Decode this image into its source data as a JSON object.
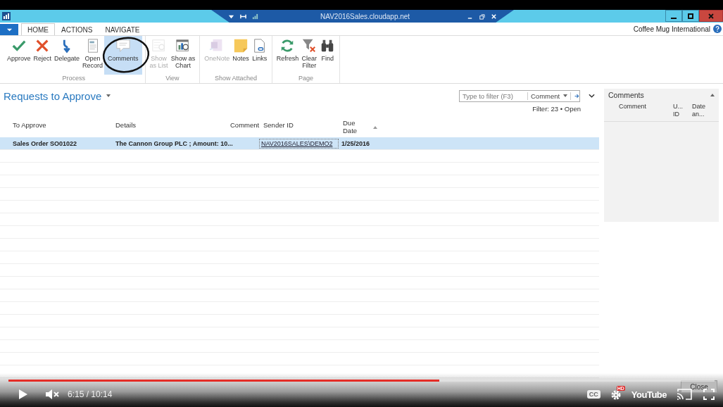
{
  "window": {
    "title": "NAV2016Sales.cloudapp.net"
  },
  "menu_tabs": [
    {
      "label": "HOME",
      "selected": true
    },
    {
      "label": "ACTIONS",
      "selected": false
    },
    {
      "label": "NAVIGATE",
      "selected": false
    }
  ],
  "company": "Coffee Mug International",
  "ribbon_groups": [
    {
      "label": "Process",
      "buttons": [
        {
          "label": "Approve",
          "disabled": false,
          "selected": false
        },
        {
          "label": "Reject",
          "disabled": false,
          "selected": false
        },
        {
          "label": "Delegate",
          "disabled": false,
          "selected": false
        },
        {
          "label": "Open\nRecord",
          "disabled": false,
          "selected": false
        },
        {
          "label": "Comments",
          "disabled": false,
          "selected": true
        }
      ]
    },
    {
      "label": "View",
      "buttons": [
        {
          "label": "Show\nas List",
          "disabled": true,
          "selected": false
        },
        {
          "label": "Show as\nChart",
          "disabled": false,
          "selected": false
        }
      ]
    },
    {
      "label": "Show Attached",
      "buttons": [
        {
          "label": "OneNote",
          "disabled": true,
          "selected": false
        },
        {
          "label": "Notes",
          "disabled": false,
          "selected": false
        },
        {
          "label": "Links",
          "disabled": false,
          "selected": false
        }
      ]
    },
    {
      "label": "Page",
      "buttons": [
        {
          "label": "Refresh",
          "disabled": false,
          "selected": false
        },
        {
          "label": "Clear\nFilter",
          "disabled": false,
          "selected": false
        },
        {
          "label": "Find",
          "disabled": false,
          "selected": false
        }
      ]
    }
  ],
  "page_title": "Requests to Approve",
  "filter": {
    "placeholder": "Type to filter (F3)",
    "field": "Comment",
    "status": "Filter: 23 • Open"
  },
  "table": {
    "columns": [
      "To Approve",
      "Details",
      "Comment",
      "Sender ID",
      "Due\nDate"
    ],
    "rows": [
      {
        "selected": true,
        "cells": [
          "Sales Order SO01022",
          "The Cannon Group PLC ; Amount: 10...",
          "",
          "NAV2016SALES\\DEMO2",
          "1/25/2016"
        ]
      }
    ]
  },
  "comments_panel": {
    "title": "Comments",
    "columns": [
      "Comment",
      "U...\nID",
      "Date\nan..."
    ]
  },
  "player": {
    "level": 0.61,
    "muted": true,
    "time": "6:15 / 10:14",
    "cc": "CC",
    "hd": "HD",
    "logo": "YouTube",
    "close": "Close"
  }
}
